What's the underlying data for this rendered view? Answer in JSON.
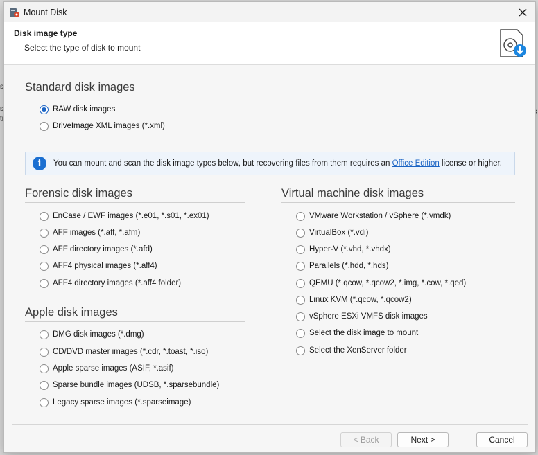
{
  "window": {
    "title": "Mount Disk"
  },
  "header": {
    "title": "Disk image type",
    "subtitle": "Select the type of disk to mount"
  },
  "sections": {
    "standard": {
      "title": "Standard disk images",
      "options": [
        "RAW disk images",
        "DriveImage XML images (*.xml)"
      ]
    },
    "forensic": {
      "title": "Forensic disk images",
      "options": [
        "EnCase / EWF images (*.e01, *.s01, *.ex01)",
        "AFF images (*.aff, *.afm)",
        "AFF directory images (*.afd)",
        "AFF4 physical images (*.aff4)",
        "AFF4 directory images (*.aff4 folder)"
      ]
    },
    "apple": {
      "title": "Apple disk images",
      "options": [
        "DMG disk images (*.dmg)",
        "CD/DVD master images (*.cdr, *.toast, *.iso)",
        "Apple sparse images (ASIF, *.asif)",
        "Sparse bundle images (UDSB, *.sparsebundle)",
        "Legacy sparse images (*.sparseimage)"
      ]
    },
    "virtual": {
      "title": "Virtual machine disk images",
      "options": [
        "VMware Workstation / vSphere (*.vmdk)",
        "VirtualBox (*.vdi)",
        "Hyper-V (*.vhd, *.vhdx)",
        "Parallels (*.hdd, *.hds)",
        "QEMU (*.qcow, *.qcow2, *.img, *.cow, *.qed)",
        "Linux KVM (*.qcow, *.qcow2)",
        "vSphere ESXi VMFS disk images",
        "Select the disk image to mount",
        "Select the XenServer folder"
      ]
    }
  },
  "info": {
    "text_before": "You can mount and scan the disk image types below, but recovering files from them requires an ",
    "link": "Office Edition",
    "text_after": " license or higher."
  },
  "buttons": {
    "back": "< Back",
    "next": "Next >",
    "cancel": "Cancel"
  },
  "colors": {
    "accent": "#1b64c4",
    "info_bg": "#eef4fb"
  }
}
